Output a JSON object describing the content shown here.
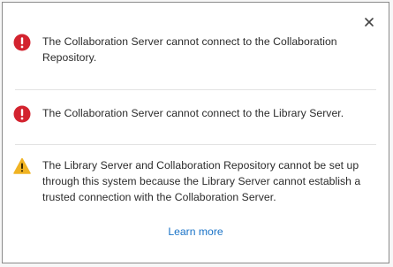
{
  "dialog": {
    "close_icon": "close-icon",
    "messages": [
      {
        "severity": "error",
        "icon": "error-icon",
        "text": "The Collaboration Server cannot connect to the Collaboration Repository."
      },
      {
        "severity": "error",
        "icon": "error-icon",
        "text": "The Collaboration Server cannot connect to the Library Server."
      },
      {
        "severity": "warning",
        "icon": "warning-icon",
        "text": "The Library Server and Collaboration Repository cannot be set up through this system because the Library Server cannot establish a trusted connection with the Collaboration Server."
      }
    ],
    "learn_more_label": "Learn more"
  },
  "colors": {
    "error": "#d3232f",
    "warning": "#f0b323",
    "link": "#1a73c7",
    "divider": "#e3e3e3",
    "text": "#2b2b2b"
  }
}
